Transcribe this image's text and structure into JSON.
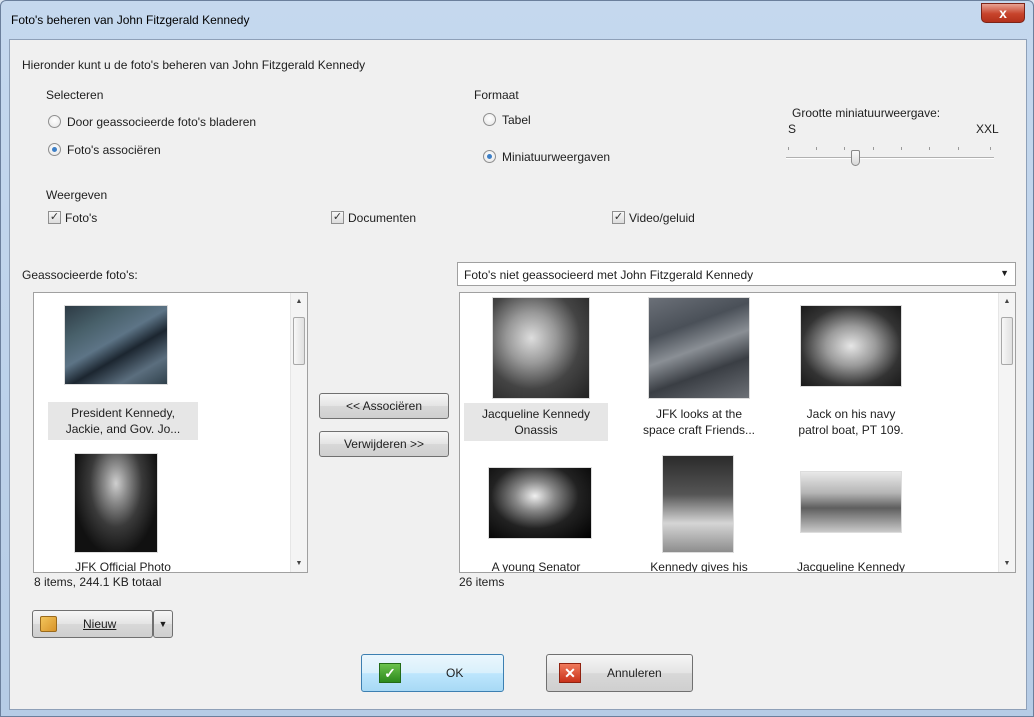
{
  "window": {
    "title": "Foto's beheren van John Fitzgerald Kennedy",
    "close_label": "x"
  },
  "instructions": "Hieronder kunt u de foto's beheren van John Fitzgerald Kennedy",
  "select_group": {
    "label": "Selecteren",
    "options": [
      "Door geassocieerde foto's bladeren",
      "Foto's associëren"
    ],
    "selected": 1
  },
  "format_group": {
    "label": "Formaat",
    "options": [
      "Tabel",
      "Miniatuurweergaven"
    ],
    "selected": 1
  },
  "size_slider": {
    "label": "Grootte miniatuurweergave:",
    "min_label": "S",
    "max_label": "XXL",
    "level_fraction": 0.32
  },
  "display_group": {
    "label": "Weergeven",
    "photos": "Foto's",
    "documents": "Documenten",
    "video": "Video/geluid"
  },
  "left_panel": {
    "label": "Geassocieerde foto's:",
    "items": [
      {
        "caption_line1": "President Kennedy,",
        "caption_line2": "Jackie, and Gov. Jo..."
      },
      {
        "caption_line1": "JFK Official Photo",
        "caption_line2": ""
      }
    ],
    "status": "8 items, 244.1 KB totaal"
  },
  "middle_buttons": {
    "associate": "<< Associëren",
    "remove": "Verwijderen >>"
  },
  "right_panel": {
    "dropdown_value": "Foto's niet geassocieerd met John Fitzgerald Kennedy",
    "items": [
      {
        "caption_line1": "Jacqueline Kennedy",
        "caption_line2": "Onassis"
      },
      {
        "caption_line1": "JFK looks at the",
        "caption_line2": "space craft Friends..."
      },
      {
        "caption_line1": "Jack on his navy",
        "caption_line2": "patrol boat, PT 109."
      },
      {
        "caption_line1": "A young Senator",
        "caption_line2": ""
      },
      {
        "caption_line1": "Kennedy gives his",
        "caption_line2": ""
      },
      {
        "caption_line1": "Jacqueline Kennedy",
        "caption_line2": ""
      }
    ],
    "status": "26 items"
  },
  "new_button": {
    "label": "Nieuw"
  },
  "ok_button": {
    "label": "OK"
  },
  "cancel_button": {
    "label": "Annuleren"
  }
}
